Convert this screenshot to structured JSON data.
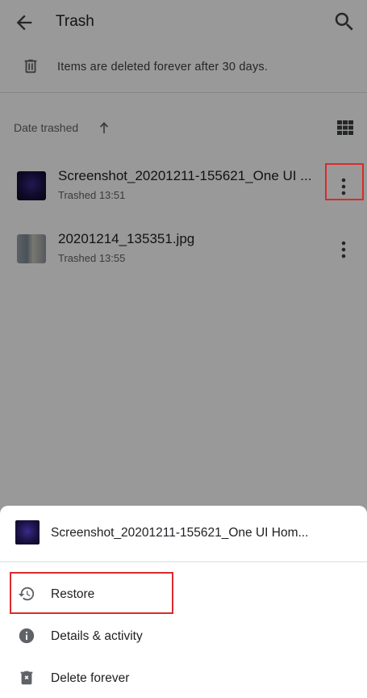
{
  "appbar": {
    "title": "Trash",
    "back_icon": "arrow-back-icon",
    "search_icon": "search-icon"
  },
  "banner": {
    "icon": "trash-icon",
    "message": "Items are deleted forever after 30 days."
  },
  "sort": {
    "label": "Date trashed",
    "direction_icon": "arrow-up-icon",
    "view_icon": "grid-view-icon"
  },
  "files": [
    {
      "name": "Screenshot_20201211-155621_One UI ...",
      "subtitle": "Trashed 13:51",
      "more_icon": "more-vert-icon"
    },
    {
      "name": "20201214_135351.jpg",
      "subtitle": "Trashed 13:55",
      "more_icon": "more-vert-icon"
    }
  ],
  "sheet": {
    "file_name": "Screenshot_20201211-155621_One UI Hom...",
    "items": [
      {
        "label": "Restore",
        "icon": "restore-history-icon"
      },
      {
        "label": "Details & activity",
        "icon": "info-icon"
      },
      {
        "label": "Delete forever",
        "icon": "delete-forever-icon"
      }
    ]
  },
  "colors": {
    "scrim": "#000000",
    "highlight": "#d92b2b",
    "text_primary": "#202124",
    "text_secondary": "#5f6368"
  }
}
